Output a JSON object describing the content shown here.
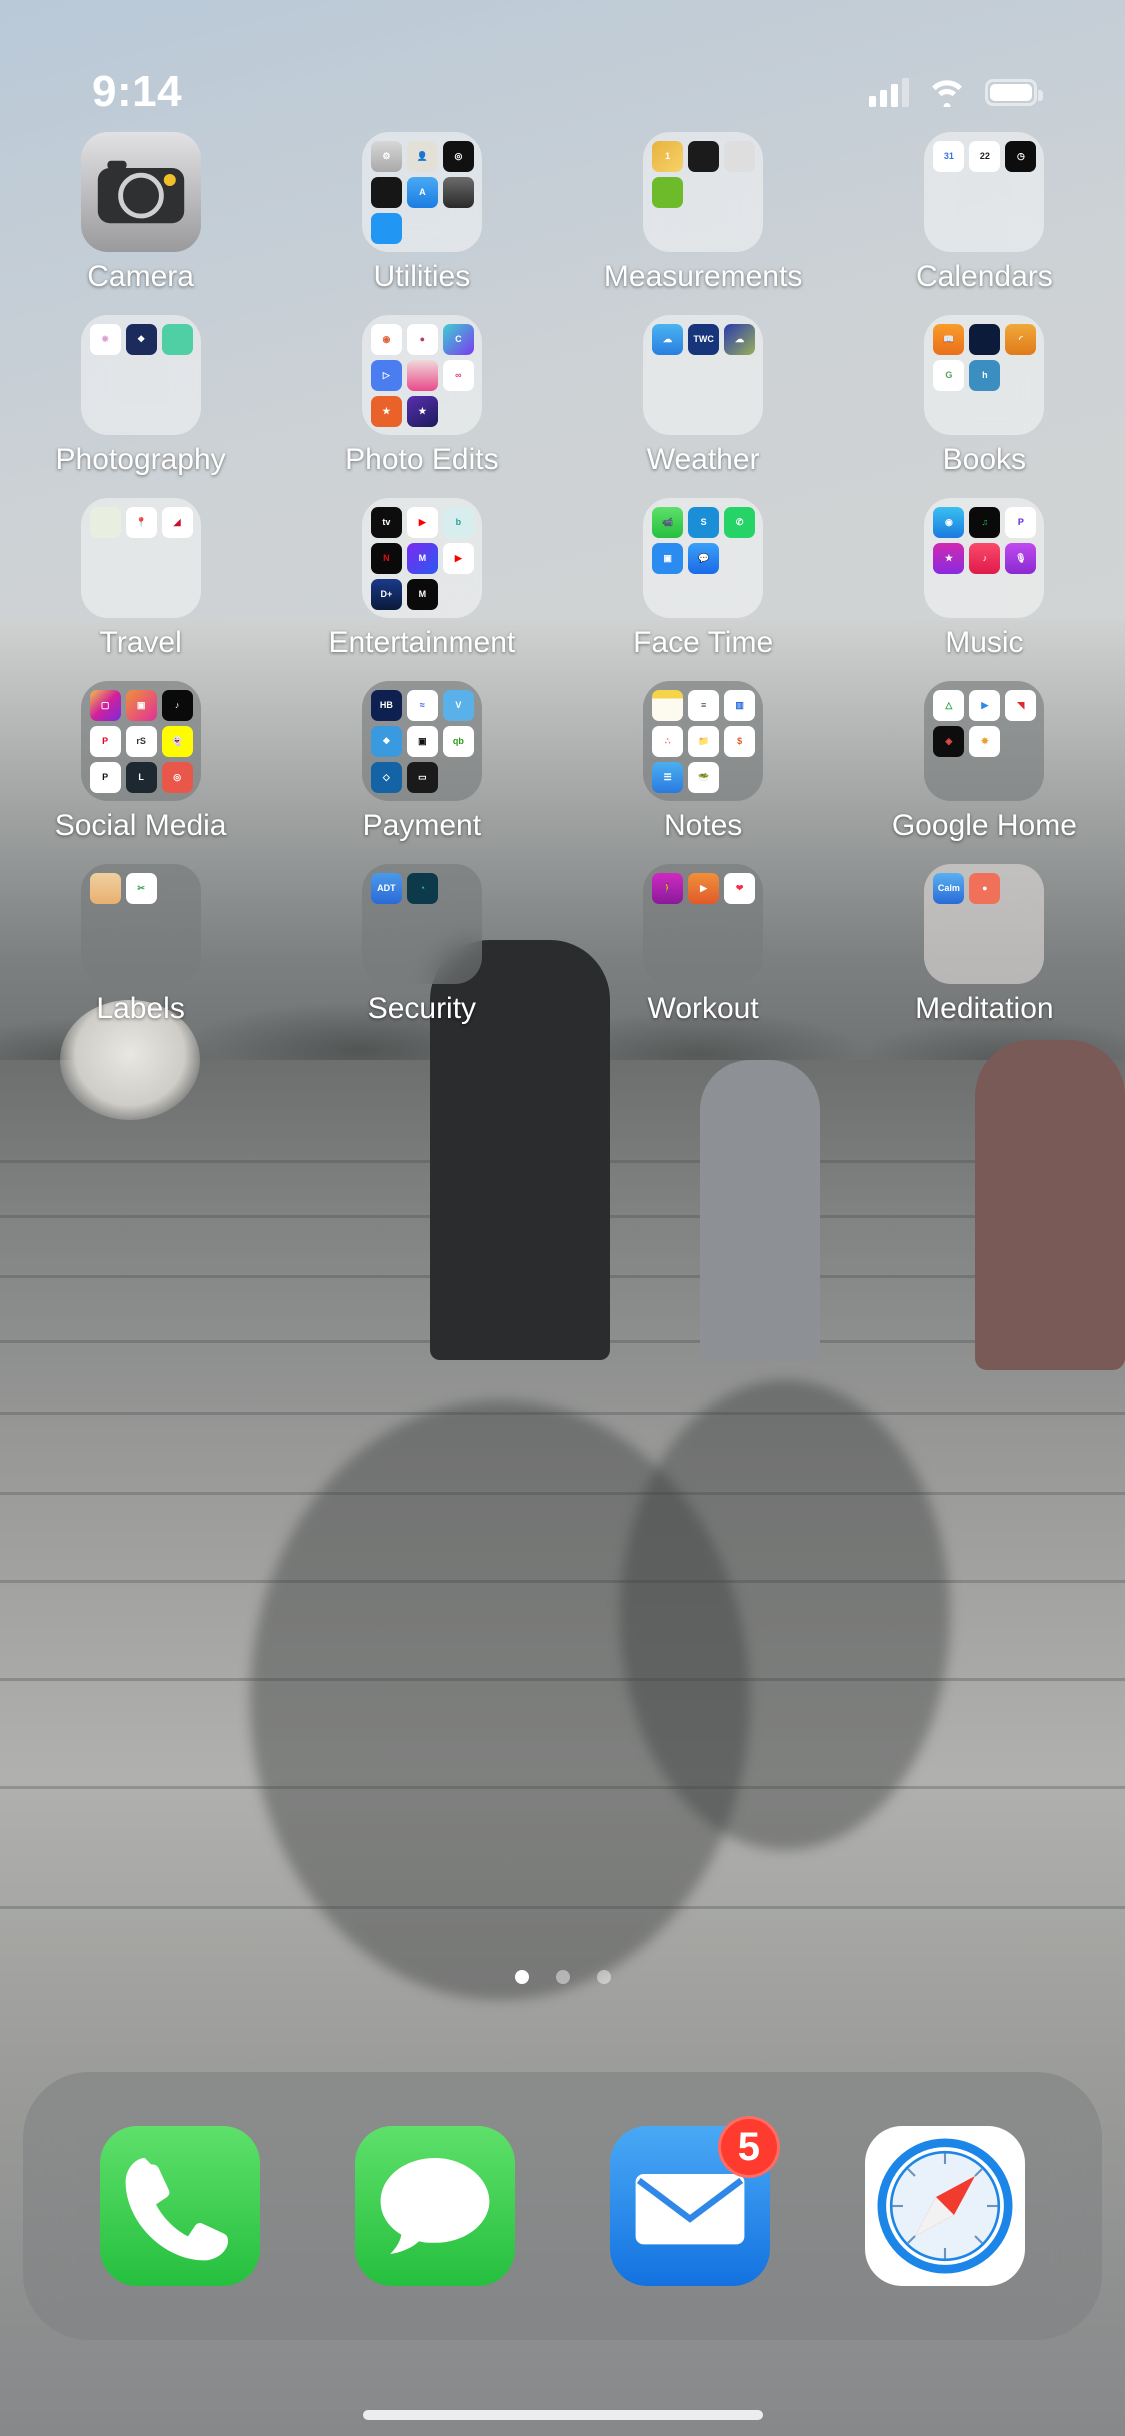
{
  "status_bar": {
    "time": "9:14",
    "cellular_icon": "signal-bars-icon",
    "wifi_icon": "wifi-icon",
    "battery_icon": "battery-icon"
  },
  "home_screen": {
    "page_indicator": {
      "total_pages": 3,
      "current_page": 1
    },
    "items": [
      {
        "label": "Camera",
        "type": "app",
        "icon": "camera-icon",
        "style": "gray"
      },
      {
        "label": "Utilities",
        "type": "folder",
        "style": "light",
        "apps": [
          "Settings",
          "Contacts",
          "Compass",
          "Voice Memos",
          "App Store",
          "Flashlight",
          "Tips"
        ]
      },
      {
        "label": "Measurements",
        "type": "folder",
        "style": "light",
        "apps": [
          "Tape Measure",
          "Measure",
          "Calculator",
          "Level"
        ]
      },
      {
        "label": "Calendars",
        "type": "folder",
        "style": "light",
        "apps": [
          "Google Calendar",
          "Calendar",
          "Clock"
        ]
      },
      {
        "label": "Photography",
        "type": "folder",
        "style": "light",
        "apps": [
          "Photos",
          "Dropbox",
          "Snapseed"
        ]
      },
      {
        "label": "Photo Edits",
        "type": "folder",
        "style": "light",
        "apps": [
          "Color Story",
          "Photo Wheel",
          "Canva",
          "Adobe Premiere Rush",
          "InstaSize",
          "Boomerang",
          "VivaVideo",
          "iMovie"
        ]
      },
      {
        "label": "Weather",
        "type": "folder",
        "style": "light",
        "apps": [
          "Weather",
          "The Weather Channel",
          "Dark Sky"
        ]
      },
      {
        "label": "Books",
        "type": "folder",
        "style": "light",
        "apps": [
          "Books",
          "Kindle",
          "Audible",
          "Goodreads",
          "hoopla"
        ]
      },
      {
        "label": "Travel",
        "type": "folder",
        "style": "light",
        "apps": [
          "Maps",
          "Google Maps",
          "Delta"
        ]
      },
      {
        "label": "Entertainment",
        "type": "folder",
        "style": "light",
        "apps": [
          "Apple TV",
          "YouTube",
          "Bravo",
          "Netflix",
          "HBO Max",
          "YouTube TV",
          "Disney+",
          "MasterClass"
        ]
      },
      {
        "label": "Face Time",
        "type": "folder",
        "style": "light",
        "apps": [
          "FaceTime",
          "Skype",
          "WhatsApp",
          "Zoom",
          "Messenger"
        ]
      },
      {
        "label": "Music",
        "type": "folder",
        "style": "light",
        "apps": [
          "Shazam",
          "Spotify",
          "Pandora",
          "iHeartRadio",
          "Apple Music",
          "Podcasts"
        ]
      },
      {
        "label": "Social Media",
        "type": "folder",
        "style": "dark",
        "apps": [
          "Instagram",
          "IGTV",
          "TikTok",
          "Pinterest",
          "reSnap",
          "Snapchat",
          "Planoly",
          "Later",
          "Lomotif"
        ]
      },
      {
        "label": "Payment",
        "type": "folder",
        "style": "dark",
        "apps": [
          "HoneyBook",
          "Wave",
          "Venmo",
          "Dropbox Payments",
          "Square",
          "QuickBooks",
          "Chase",
          "Wallet"
        ]
      },
      {
        "label": "Notes",
        "type": "folder",
        "style": "dark",
        "apps": [
          "Notes",
          "Reminders",
          "Trello",
          "Asana",
          "Files",
          "Stocks",
          "Pages",
          "AnyList"
        ]
      },
      {
        "label": "Google Home",
        "type": "folder",
        "style": "dark",
        "apps": [
          "Google Drive",
          "Google Play",
          "Google News",
          "Nest",
          "Google Photos"
        ]
      },
      {
        "label": "Labels",
        "type": "folder",
        "style": "dark",
        "apps": [
          "Brother P-touch",
          "Cricut Design Space"
        ]
      },
      {
        "label": "Security",
        "type": "folder",
        "style": "dark",
        "apps": [
          "ADT",
          "Ring"
        ]
      },
      {
        "label": "Workout",
        "type": "folder",
        "style": "dark",
        "apps": [
          "Fitness",
          "Peloton",
          "Health"
        ]
      },
      {
        "label": "Meditation",
        "type": "folder",
        "style": "light",
        "apps": [
          "Calm",
          "Headspace"
        ]
      }
    ]
  },
  "dock": {
    "items": [
      {
        "label": "Phone",
        "icon": "phone-icon",
        "badge": ""
      },
      {
        "label": "Messages",
        "icon": "messages-icon",
        "badge": ""
      },
      {
        "label": "Mail",
        "icon": "mail-icon",
        "badge": "5"
      },
      {
        "label": "Safari",
        "icon": "safari-compass-icon",
        "badge": ""
      }
    ]
  },
  "colors": {
    "badge_red": "#ff3b30",
    "phone_green": "#4cd964",
    "mail_blue": "#1d8cf0",
    "safari_blue": "#1b7ce0"
  }
}
